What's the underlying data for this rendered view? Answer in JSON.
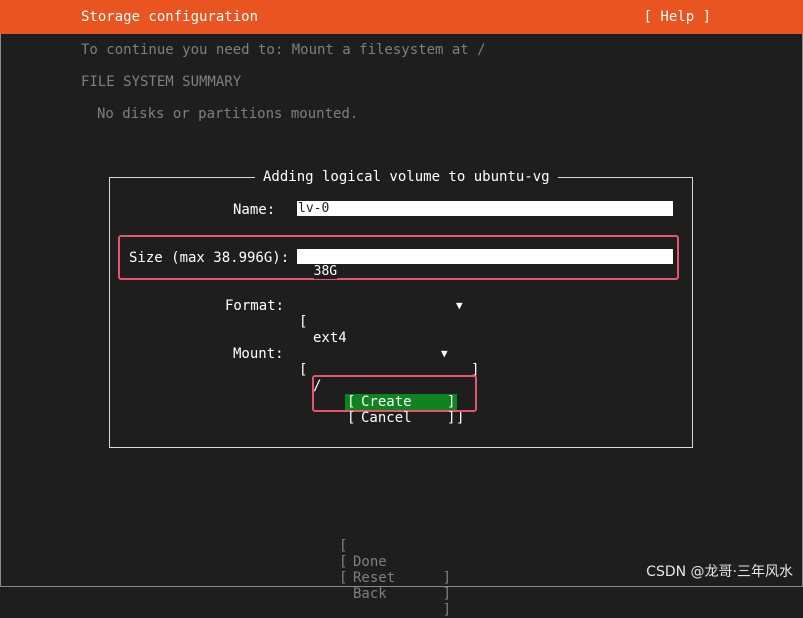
{
  "header": {
    "title": "Storage configuration",
    "help": "[ Help ]"
  },
  "notice": "To continue you need to: Mount a filesystem at /",
  "summary": {
    "heading": "FILE SYSTEM SUMMARY",
    "empty": "No disks or partitions mounted."
  },
  "dialog": {
    "title": "Adding logical volume to ubuntu-vg",
    "name_label": "Name:",
    "name_value": "lv-0",
    "size_label": "Size (max 38.996G):",
    "size_value": "38G",
    "format_label": "Format:",
    "format_value": "ext4",
    "mount_label": "Mount:",
    "mount_value": "/",
    "create_label": "Create",
    "cancel_label": "Cancel"
  },
  "footer": {
    "done": "Done",
    "reset": "Reset",
    "back": "Back"
  },
  "watermark": "CSDN @龙哥·三年风水",
  "icons": {
    "dropdown": "triangle-down-icon"
  },
  "colors": {
    "header": "#e95420",
    "selected_button": "#0e8420",
    "annotation": "#e4566b",
    "background": "#1e1e1e"
  }
}
